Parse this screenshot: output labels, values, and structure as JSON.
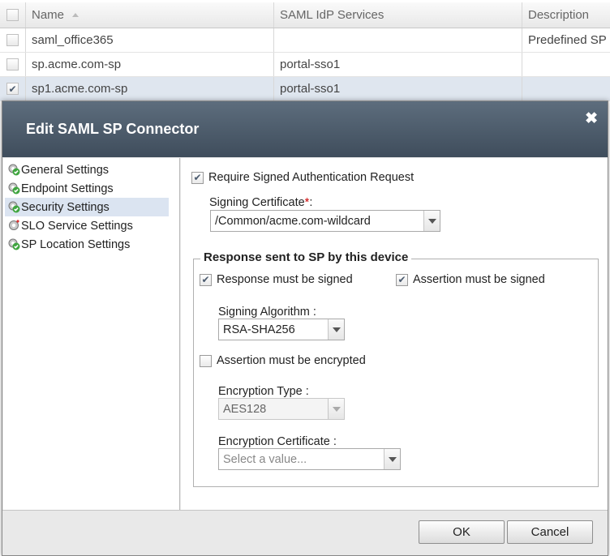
{
  "table": {
    "columns": {
      "name": "Name",
      "idp": "SAML IdP Services",
      "desc": "Description"
    },
    "rows": [
      {
        "name": "saml_office365",
        "idp": "",
        "desc": "Predefined SP",
        "checked": false
      },
      {
        "name": "sp.acme.com-sp",
        "idp": "portal-sso1",
        "desc": "",
        "checked": false
      },
      {
        "name": "sp1.acme.com-sp",
        "idp": "portal-sso1",
        "desc": "",
        "checked": true
      }
    ]
  },
  "dialog": {
    "title": "Edit SAML SP Connector",
    "close_icon": "close-icon",
    "nav": [
      {
        "label": "General Settings",
        "icon": "gear-check-icon",
        "active": false
      },
      {
        "label": "Endpoint Settings",
        "icon": "gear-check-icon",
        "active": false
      },
      {
        "label": "Security Settings",
        "icon": "gear-check-icon",
        "active": true
      },
      {
        "label": "SLO Service Settings",
        "icon": "gear-icon",
        "active": false
      },
      {
        "label": "SP Location Settings",
        "icon": "gear-check-icon",
        "active": false
      }
    ],
    "security": {
      "require_signed_label": "Require Signed Authentication Request",
      "require_signed_checked": true,
      "signing_cert_label": "Signing Certificate",
      "signing_cert_required": "*",
      "signing_cert_colon": ":",
      "signing_cert_value": "/Common/acme.com-wildcard",
      "response_legend": "Response sent to SP by this device",
      "response_signed_label": "Response must be signed",
      "response_signed_checked": true,
      "assertion_signed_label": "Assertion must be signed",
      "assertion_signed_checked": true,
      "signing_algo_label": "Signing Algorithm  :",
      "signing_algo_value": "RSA-SHA256",
      "assertion_encrypted_label": "Assertion must be encrypted",
      "assertion_encrypted_checked": false,
      "enc_type_label": "Encryption Type  :",
      "enc_type_value": "AES128",
      "enc_cert_label": "Encryption Certificate  :",
      "enc_cert_placeholder": "Select a value..."
    },
    "ok_label": "OK",
    "cancel_label": "Cancel"
  },
  "colors": {
    "title_bar": "#4e5d6c",
    "active_nav": "#dbe4f1",
    "selected_row": "#dfe6ef",
    "required": "#cc0000"
  }
}
